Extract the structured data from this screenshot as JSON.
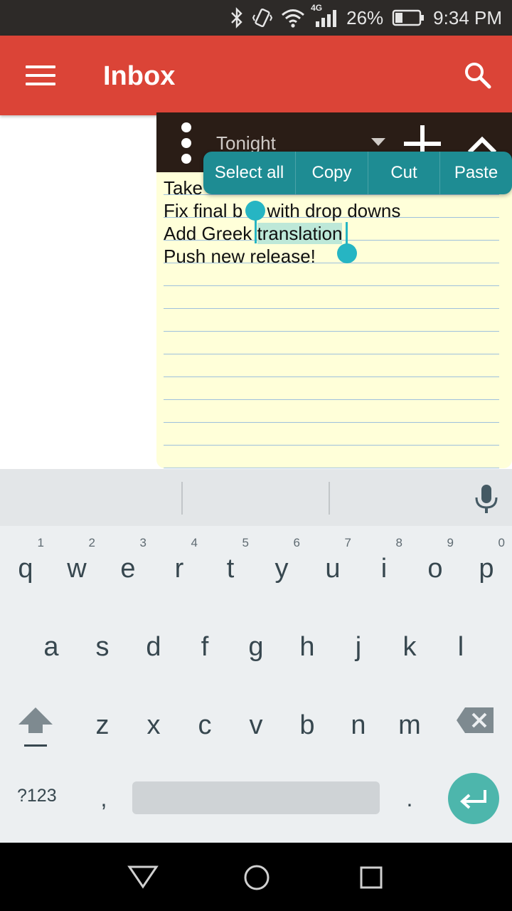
{
  "status_bar": {
    "icons": [
      "bluetooth-icon",
      "vibrate-icon",
      "wifi-icon",
      "signal-4g-icon",
      "battery-icon"
    ],
    "network_label": "4G",
    "battery": "26%",
    "time": "9:34 PM"
  },
  "app_bar": {
    "title": "Inbox",
    "left_icon": "menu-icon",
    "right_icon": "search-icon",
    "color": "#db4437"
  },
  "note": {
    "dropdown_value": "Tonight",
    "lines": [
      "Take",
      "Fix final bugs with drop downs",
      "Add Greek translation",
      "Push new release!"
    ],
    "line_1_prefix": "Fix final b",
    "line_1_suffix": "s with drop downs",
    "line_2_prefix": "Add Greek ",
    "selected_text": "translation",
    "background": "#ffffd9"
  },
  "context_menu": {
    "items": [
      "Select all",
      "Copy",
      "Cut",
      "Paste"
    ],
    "color": "#1e8c93"
  },
  "keyboard": {
    "row1": [
      {
        "key": "q",
        "hint": "1"
      },
      {
        "key": "w",
        "hint": "2"
      },
      {
        "key": "e",
        "hint": "3"
      },
      {
        "key": "r",
        "hint": "4"
      },
      {
        "key": "t",
        "hint": "5"
      },
      {
        "key": "y",
        "hint": "6"
      },
      {
        "key": "u",
        "hint": "7"
      },
      {
        "key": "i",
        "hint": "8"
      },
      {
        "key": "o",
        "hint": "9"
      },
      {
        "key": "p",
        "hint": "0"
      }
    ],
    "row2": [
      "a",
      "s",
      "d",
      "f",
      "g",
      "h",
      "j",
      "k",
      "l"
    ],
    "row3": [
      "z",
      "x",
      "c",
      "v",
      "b",
      "n",
      "m"
    ],
    "symbols_label": "?123",
    "comma": ",",
    "period": ".",
    "enter_color": "#4db6ac"
  },
  "nav_bar": {
    "icons": [
      "back-icon",
      "home-icon",
      "recents-icon"
    ]
  }
}
